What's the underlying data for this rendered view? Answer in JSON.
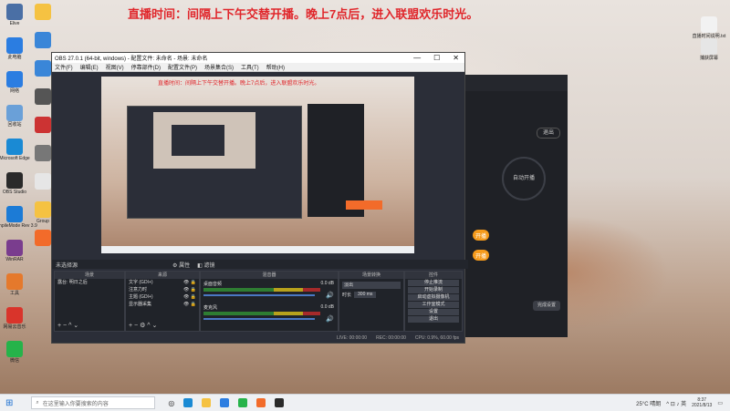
{
  "banner": "直播时间：间隔上下午交替开播。晚上7点后，进入联盟欢乐时光。",
  "desktop_left": [
    {
      "label": "Elive",
      "icon": "app-icon",
      "color": "#4a6fa5"
    },
    {
      "label": "此电脑",
      "icon": "computer-icon",
      "color": "#2b7de1"
    },
    {
      "label": "网络",
      "icon": "network-icon",
      "color": "#2b7de1"
    },
    {
      "label": "回收站",
      "icon": "recycle-bin-icon",
      "color": "#6aa0d8"
    },
    {
      "label": "Microsoft Edge",
      "icon": "edge-icon",
      "color": "#1a8ad4"
    },
    {
      "label": "OBS Studio",
      "icon": "obs-icon",
      "color": "#2a2a2a"
    },
    {
      "label": "CompileMode Rev 3.9",
      "icon": "app-icon",
      "color": "#1c7bd6"
    },
    {
      "label": "WinRAR",
      "icon": "winrar-icon",
      "color": "#7a3d8e"
    },
    {
      "label": "工具",
      "icon": "tool-icon",
      "color": "#e5792c"
    },
    {
      "label": "网易云音乐",
      "icon": "music-icon",
      "color": "#d9342b"
    },
    {
      "label": "微信",
      "icon": "wechat-icon",
      "color": "#26b34a"
    }
  ],
  "desktop_col2": [
    {
      "label": "",
      "icon": "folder-icon",
      "color": "#f5c242"
    },
    {
      "label": "",
      "icon": "app-icon",
      "color": "#3a86d8"
    },
    {
      "label": "",
      "icon": "app-icon",
      "color": "#3a86d8"
    },
    {
      "label": "",
      "icon": "app-icon",
      "color": "#555"
    },
    {
      "label": "",
      "icon": "app-icon",
      "color": "#c33"
    },
    {
      "label": "",
      "icon": "app-icon",
      "color": "#777"
    },
    {
      "label": "",
      "icon": "document-icon",
      "color": "#e6e6e6"
    },
    {
      "label": "Group",
      "icon": "folder-icon",
      "color": "#f5c242"
    },
    {
      "label": "",
      "icon": "app-icon",
      "color": "#f26b2a"
    }
  ],
  "desktop_right": [
    {
      "label": "直播时间说明.txt",
      "icon": "document-icon",
      "color": "#f2f2f2"
    },
    {
      "label": "捕获屏幕",
      "icon": "document-icon",
      "color": "#e6e6e6"
    }
  ],
  "obs": {
    "title": "OBS 27.0.1 (64-bit, windows) - 配置文件: 未命名 - 场景: 未命名",
    "menu": [
      "文件(F)",
      "编辑(E)",
      "视图(V)",
      "停靠部件(D)",
      "配置文件(P)",
      "场景集合(S)",
      "工具(T)",
      "帮助(H)"
    ],
    "window_controls": [
      "—",
      "☐",
      "✕"
    ],
    "no_source": "未选择源",
    "props_btn": "属性",
    "filters_btn": "滤镜",
    "docks": {
      "scenes": {
        "title": "场景",
        "items": [
          "露台: 明日之后"
        ]
      },
      "sources": {
        "title": "来源",
        "items": [
          "文字 (GDI+)",
          "注意力时",
          "主题 (GDI+)",
          "显示器采集"
        ]
      },
      "mixer": {
        "title": "混音器",
        "channels": [
          {
            "name": "桌面音频",
            "db": "0.0 dB"
          },
          {
            "name": "麦克风",
            "db": "0.0 dB"
          }
        ]
      },
      "transitions": {
        "title": "场景转换",
        "type": "淡出",
        "duration_label": "时长",
        "duration": "300 ms"
      },
      "controls": {
        "title": "控件",
        "buttons": [
          "停止推流",
          "开始录制",
          "启动虚拟摄像机",
          "工作室模式",
          "设置",
          "退出"
        ]
      }
    },
    "statusbar": {
      "live": "LIVE: 00:00:00",
      "rec": "REC: 00:00:00",
      "cpu": "CPU: 0.9%, 60.00 fps"
    }
  },
  "dark_app": {
    "logout": "退出",
    "auto_label": "自动开播",
    "pill1": "开播",
    "pill2": "开播",
    "footer_btn": "完成设置"
  },
  "taskbar": {
    "search_placeholder": "在这里输入你要搜索的内容",
    "weather": "25°C 晴朗",
    "time": "8:37",
    "date": "2021/8/13"
  }
}
